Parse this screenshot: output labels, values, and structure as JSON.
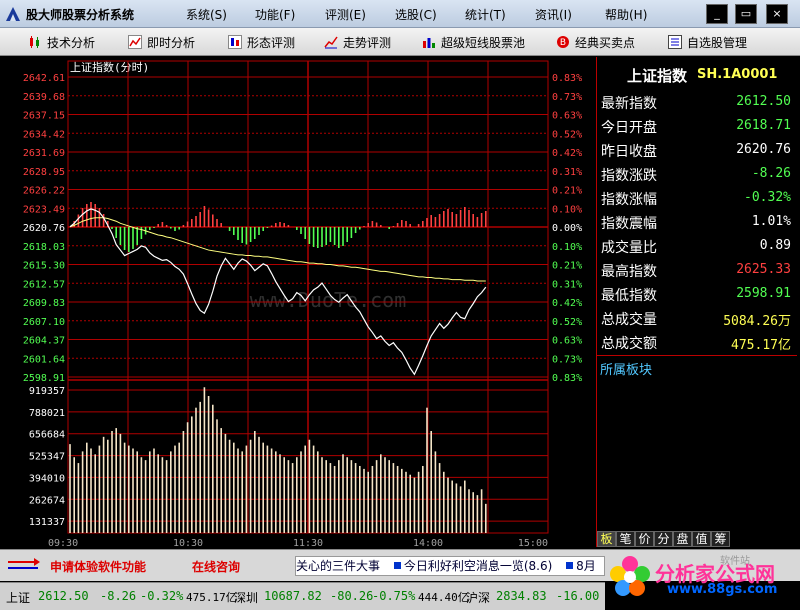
{
  "window": {
    "title": "股大师股票分析系统",
    "minimize": "_",
    "restore": "▭",
    "close": "×"
  },
  "menu": [
    "系统(S)",
    "功能(F)",
    "评测(E)",
    "选股(C)",
    "统计(T)",
    "资讯(I)",
    "帮助(H)"
  ],
  "toolbar": [
    {
      "label": "技术分析",
      "icon": "candlestick-icon"
    },
    {
      "label": "即时分析",
      "icon": "line-chart-icon"
    },
    {
      "label": "形态评测",
      "icon": "pattern-icon"
    },
    {
      "label": "走势评测",
      "icon": "trend-icon"
    },
    {
      "label": "超级短线股票池",
      "icon": "bar-chart-icon"
    },
    {
      "label": "经典买卖点",
      "icon": "buy-sell-icon"
    },
    {
      "label": "自选股管理",
      "icon": "watchlist-icon"
    }
  ],
  "chart_data": {
    "type": "line",
    "title": "上证指数(分时)",
    "price_axis": [
      "2642.61",
      "2639.68",
      "2637.15",
      "2634.42",
      "2631.69",
      "2628.95",
      "2626.22",
      "2623.49",
      "2620.76",
      "2618.03",
      "2615.30",
      "2612.57",
      "2609.83",
      "2607.10",
      "2604.37",
      "2601.64",
      "2598.91"
    ],
    "pct_axis": [
      "0.83%",
      "0.73%",
      "0.63%",
      "0.52%",
      "0.42%",
      "0.31%",
      "0.21%",
      "0.10%",
      "0.00%",
      "0.10%",
      "0.21%",
      "0.31%",
      "0.42%",
      "0.52%",
      "0.63%",
      "0.73%",
      "0.83%"
    ],
    "volume_axis": [
      "919357",
      "788021",
      "656684",
      "525347",
      "394010",
      "262674",
      "131337"
    ],
    "time_axis": [
      "09:30",
      "10:30",
      "11:30",
      "14:00",
      "15:00"
    ],
    "ylim": [
      2598.91,
      2642.61
    ],
    "prev_close": 2620.76,
    "volume_max": 1050000,
    "minutes_total": 240,
    "price": [
      2620.8,
      2621.3,
      2622.0,
      2622.6,
      2623.1,
      2623.4,
      2623.2,
      2622.9,
      2622.1,
      2621.0,
      2619.8,
      2618.2,
      2617.4,
      2616.6,
      2616.9,
      2617.2,
      2617.5,
      2618.0,
      2617.8,
      2617.0,
      2616.5,
      2616.2,
      2615.9,
      2616.0,
      2615.6,
      2615.0,
      2614.6,
      2613.9,
      2612.5,
      2611.0,
      2609.6,
      2608.6,
      2608.2,
      2609.5,
      2611.4,
      2613.6,
      2615.1,
      2616.2,
      2615.4,
      2614.6,
      2615.5,
      2616.1,
      2615.8,
      2615.2,
      2614.4,
      2614.9,
      2615.4,
      2615.1,
      2614.0,
      2612.8,
      2611.8,
      2610.8,
      2609.9,
      2610.3,
      2611.2,
      2610.8,
      2610.0,
      2610.9,
      2611.6,
      2612.0,
      2612.6,
      2611.7,
      2610.8,
      2610.2,
      2609.8,
      2610.4,
      2610.9,
      2610.0,
      2609.1,
      2608.4,
      2607.3,
      2606.2,
      2605.4,
      2604.5,
      2604.9,
      2604.1,
      2603.5,
      2603.9,
      2603.1,
      2602.5,
      2601.4,
      2600.2,
      2599.3,
      2600.6,
      2602.0,
      2603.5,
      2604.9,
      2605.8,
      2606.7,
      2606.0,
      2606.6,
      2607.5,
      2608.3,
      2607.6,
      2607.4,
      2608.7,
      2609.6,
      2610.6,
      2611.2,
      2612.0
    ],
    "avg": [
      2620.8,
      2621.0,
      2621.3,
      2621.6,
      2621.8,
      2622.0,
      2622.1,
      2622.1,
      2622.1,
      2622.0,
      2621.8,
      2621.6,
      2621.3,
      2621.1,
      2620.9,
      2620.7,
      2620.5,
      2620.4,
      2620.2,
      2620.0,
      2619.8,
      2619.6,
      2619.5,
      2619.3,
      2619.2,
      2619.0,
      2618.8,
      2618.6,
      2618.4,
      2618.2,
      2618.0,
      2617.8,
      2617.6,
      2617.4,
      2617.3,
      2617.2,
      2617.1,
      2617.0,
      2616.9,
      2616.8,
      2616.7,
      2616.7,
      2616.6,
      2616.6,
      2616.5,
      2616.5,
      2616.4,
      2616.4,
      2616.3,
      2616.2,
      2616.1,
      2616.0,
      2615.9,
      2615.8,
      2615.7,
      2615.7,
      2615.6,
      2615.5,
      2615.5,
      2615.4,
      2615.4,
      2615.3,
      2615.3,
      2615.2,
      2615.1,
      2615.1,
      2615.0,
      2614.9,
      2614.9,
      2614.8,
      2614.7,
      2614.6,
      2614.5,
      2614.4,
      2614.3,
      2614.3,
      2614.2,
      2614.1,
      2614.0,
      2613.9,
      2613.8,
      2613.7,
      2613.6,
      2613.5,
      2613.5,
      2613.4,
      2613.4,
      2613.3,
      2613.3,
      2613.2,
      2613.2,
      2613.1,
      2613.1,
      2613.1,
      2613.0,
      2613.0,
      2613.0,
      2612.9,
      2612.9,
      2612.9
    ],
    "strength": [
      0,
      1.2,
      2.5,
      3.8,
      4.6,
      5.0,
      4.6,
      3.8,
      2.6,
      1.2,
      -0.4,
      -2.2,
      -3.6,
      -4.6,
      -5.0,
      -4.4,
      -3.6,
      -2.4,
      -1.5,
      -0.6,
      -0.2,
      0.6,
      1.0,
      0.4,
      -0.3,
      -0.8,
      -0.5,
      0.4,
      1.1,
      1.6,
      2.2,
      3.0,
      4.2,
      3.5,
      2.5,
      1.6,
      0.8,
      0.0,
      -0.8,
      -1.6,
      -2.6,
      -3.2,
      -3.5,
      -3.0,
      -2.4,
      -1.6,
      -0.8,
      -0.2,
      0.3,
      0.8,
      1.0,
      0.8,
      0.4,
      0.0,
      -0.6,
      -1.4,
      -2.4,
      -3.4,
      -4.0,
      -4.2,
      -4.0,
      -3.6,
      -3.0,
      -3.6,
      -4.2,
      -3.8,
      -3.0,
      -2.2,
      -1.2,
      -0.5,
      0.2,
      0.8,
      1.2,
      0.9,
      0.4,
      0.0,
      -0.4,
      0.2,
      0.8,
      1.4,
      1.2,
      0.6,
      0.0,
      0.6,
      1.2,
      1.8,
      2.4,
      2.0,
      2.6,
      3.2,
      3.6,
      3.0,
      2.6,
      3.4,
      4.0,
      3.4,
      2.6,
      2.0,
      2.8,
      3.2
    ],
    "volume": [
      610000,
      520000,
      480000,
      560000,
      620000,
      580000,
      540000,
      600000,
      660000,
      640000,
      700000,
      720000,
      680000,
      620000,
      600000,
      580000,
      560000,
      520000,
      500000,
      560000,
      580000,
      540000,
      520000,
      500000,
      560000,
      600000,
      620000,
      700000,
      760000,
      800000,
      860000,
      900000,
      1000000,
      940000,
      880000,
      780000,
      720000,
      680000,
      640000,
      620000,
      580000,
      560000,
      600000,
      640000,
      700000,
      660000,
      620000,
      600000,
      580000,
      560000,
      540000,
      520000,
      500000,
      480000,
      520000,
      560000,
      600000,
      640000,
      600000,
      560000,
      520000,
      500000,
      480000,
      460000,
      500000,
      540000,
      520000,
      500000,
      480000,
      460000,
      440000,
      420000,
      460000,
      500000,
      540000,
      520000,
      500000,
      480000,
      460000,
      440000,
      420000,
      400000,
      380000,
      420000,
      460000,
      860000,
      700000,
      560000,
      480000,
      420000,
      380000,
      360000,
      340000,
      320000,
      360000,
      300000,
      280000,
      260000,
      300000,
      200000
    ]
  },
  "quote": {
    "name": "上证指数",
    "code": "SH.1A0001",
    "rows": [
      {
        "label": "最新指数",
        "value": "2612.50",
        "color": "#52ff52"
      },
      {
        "label": "今日开盘",
        "value": "2618.71",
        "color": "#52ff52"
      },
      {
        "label": "昨日收盘",
        "value": "2620.76",
        "color": "#ffffff"
      },
      {
        "label": "指数涨跌",
        "value": "-8.26",
        "color": "#52ff52"
      },
      {
        "label": "指数涨幅",
        "value": "-0.32%",
        "color": "#52ff52"
      },
      {
        "label": "指数震幅",
        "value": "1.01%",
        "color": "#ffffff"
      },
      {
        "label": "成交量比",
        "value": "0.89",
        "color": "#ffffff"
      },
      {
        "label": "最高指数",
        "value": "2625.33",
        "color": "#ff4040"
      },
      {
        "label": "最低指数",
        "value": "2598.91",
        "color": "#52ff52"
      },
      {
        "label": "总成交量",
        "value": "5084.26万",
        "color": "#ffff54"
      },
      {
        "label": "总成交额",
        "value": "475.17亿",
        "color": "#ffff54"
      }
    ],
    "sector_title": "所属板块",
    "tabs": [
      "板",
      "笔",
      "价",
      "分",
      "盘",
      "值",
      "筹"
    ]
  },
  "ticker": {
    "promo1": "申请体验软件功能",
    "promo2": "在线咨询",
    "news": [
      "关心的三件大事",
      "今日利好利空消息一览(8.6)",
      "8月"
    ]
  },
  "logo": {
    "text": "分析家公式网",
    "url": "www.88gs.com",
    "sub": "软件站"
  },
  "status": {
    "sh_name": "上证",
    "sh_price": "2612.50",
    "sh_change": "-8.26",
    "sh_pct": "-0.32%",
    "sh_amount": "475.17亿",
    "sz_name": "深圳",
    "sz_price": "10687.82",
    "sz_change": "-80.26",
    "sz_pct": "-0.75%",
    "sz_amount": "444.40亿",
    "hs_name": "沪深",
    "hs_price": "2834.83",
    "hs_change": "-16.00"
  },
  "watermark": "www.DuoTe.com",
  "colors": {
    "grid": "#b00000",
    "up": "#ff4040",
    "down": "#52ff52",
    "price_line": "#ffffff",
    "avg_line": "#ffff80",
    "volume": "#f5e6c8"
  }
}
